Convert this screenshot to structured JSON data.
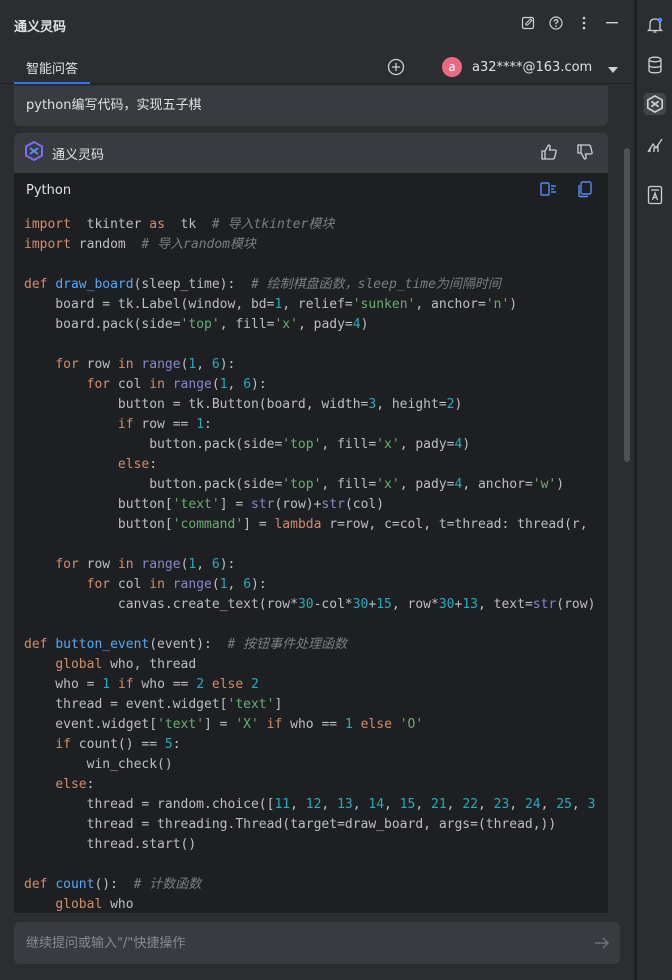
{
  "window": {
    "title": "通义灵码"
  },
  "tabs": [
    {
      "label": "智能问答"
    }
  ],
  "account": {
    "avatar_letter": "a",
    "email": "a32****@163.com"
  },
  "user_message": "python编写代码，实现五子棋",
  "answer": {
    "bot_name": "通义灵码",
    "code_language": "Python"
  },
  "code_lines": [
    [
      [
        "kw",
        "import"
      ],
      [
        "",
        "  tkinter "
      ],
      [
        "kw",
        "as"
      ],
      [
        "",
        "  tk  "
      ],
      [
        "cm",
        "# 导入tkinter模块"
      ]
    ],
    [
      [
        "kw",
        "import"
      ],
      [
        "",
        " random  "
      ],
      [
        "cm",
        "# 导入random模块"
      ]
    ],
    [],
    [
      [
        "kw",
        "def"
      ],
      [
        "",
        " "
      ],
      [
        "fn",
        "draw_board"
      ],
      [
        "",
        "(sleep_time):  "
      ],
      [
        "cm",
        "# 绘制棋盘函数，sleep_time为间隔时间"
      ]
    ],
    [
      [
        "",
        "    board = tk.Label(window, bd="
      ],
      [
        "num",
        "1"
      ],
      [
        "",
        ", relief="
      ],
      [
        "str",
        "'sunken'"
      ],
      [
        "",
        ", anchor="
      ],
      [
        "str",
        "'n'"
      ],
      [
        "",
        ")"
      ]
    ],
    [
      [
        "",
        "    board.pack(side="
      ],
      [
        "str",
        "'top'"
      ],
      [
        "",
        ", fill="
      ],
      [
        "str",
        "'x'"
      ],
      [
        "",
        ", pady="
      ],
      [
        "num",
        "4"
      ],
      [
        "",
        ")"
      ]
    ],
    [],
    [
      [
        "",
        "    "
      ],
      [
        "kw",
        "for"
      ],
      [
        "",
        " row "
      ],
      [
        "kw",
        "in"
      ],
      [
        "",
        " "
      ],
      [
        "bi",
        "range"
      ],
      [
        "",
        "("
      ],
      [
        "num",
        "1"
      ],
      [
        "",
        ", "
      ],
      [
        "num",
        "6"
      ],
      [
        "",
        "):"
      ]
    ],
    [
      [
        "",
        "        "
      ],
      [
        "kw",
        "for"
      ],
      [
        "",
        " col "
      ],
      [
        "kw",
        "in"
      ],
      [
        "",
        " "
      ],
      [
        "bi",
        "range"
      ],
      [
        "",
        "("
      ],
      [
        "num",
        "1"
      ],
      [
        "",
        ", "
      ],
      [
        "num",
        "6"
      ],
      [
        "",
        "):"
      ]
    ],
    [
      [
        "",
        "            button = tk.Button(board, width="
      ],
      [
        "num",
        "3"
      ],
      [
        "",
        ", height="
      ],
      [
        "num",
        "2"
      ],
      [
        "",
        ")"
      ]
    ],
    [
      [
        "",
        "            "
      ],
      [
        "kw",
        "if"
      ],
      [
        "",
        " row == "
      ],
      [
        "num",
        "1"
      ],
      [
        "",
        ":"
      ]
    ],
    [
      [
        "",
        "                button.pack(side="
      ],
      [
        "str",
        "'top'"
      ],
      [
        "",
        ", fill="
      ],
      [
        "str",
        "'x'"
      ],
      [
        "",
        ", pady="
      ],
      [
        "num",
        "4"
      ],
      [
        "",
        ")"
      ]
    ],
    [
      [
        "",
        "            "
      ],
      [
        "kw",
        "else"
      ],
      [
        "",
        ":"
      ]
    ],
    [
      [
        "",
        "                button.pack(side="
      ],
      [
        "str",
        "'top'"
      ],
      [
        "",
        ", fill="
      ],
      [
        "str",
        "'x'"
      ],
      [
        "",
        ", pady="
      ],
      [
        "num",
        "4"
      ],
      [
        "",
        ", anchor="
      ],
      [
        "str",
        "'w'"
      ],
      [
        "",
        ")"
      ]
    ],
    [
      [
        "",
        "            button["
      ],
      [
        "str",
        "'text'"
      ],
      [
        "",
        "] = "
      ],
      [
        "bi",
        "str"
      ],
      [
        "",
        "(row)+"
      ],
      [
        "bi",
        "str"
      ],
      [
        "",
        "(col)"
      ]
    ],
    [
      [
        "",
        "            button["
      ],
      [
        "str",
        "'command'"
      ],
      [
        "",
        "] = "
      ],
      [
        "kw",
        "lambda"
      ],
      [
        "",
        " r=row, c=col, t=thread: thread(r,"
      ]
    ],
    [],
    [
      [
        "",
        "    "
      ],
      [
        "kw",
        "for"
      ],
      [
        "",
        " row "
      ],
      [
        "kw",
        "in"
      ],
      [
        "",
        " "
      ],
      [
        "bi",
        "range"
      ],
      [
        "",
        "("
      ],
      [
        "num",
        "1"
      ],
      [
        "",
        ", "
      ],
      [
        "num",
        "6"
      ],
      [
        "",
        "):"
      ]
    ],
    [
      [
        "",
        "        "
      ],
      [
        "kw",
        "for"
      ],
      [
        "",
        " col "
      ],
      [
        "kw",
        "in"
      ],
      [
        "",
        " "
      ],
      [
        "bi",
        "range"
      ],
      [
        "",
        "("
      ],
      [
        "num",
        "1"
      ],
      [
        "",
        ", "
      ],
      [
        "num",
        "6"
      ],
      [
        "",
        "):"
      ]
    ],
    [
      [
        "",
        "            canvas.create_text(row*"
      ],
      [
        "num",
        "30"
      ],
      [
        "",
        "-col*"
      ],
      [
        "num",
        "30"
      ],
      [
        "",
        "+"
      ],
      [
        "num",
        "15"
      ],
      [
        "",
        ", row*"
      ],
      [
        "num",
        "30"
      ],
      [
        "",
        "+"
      ],
      [
        "num",
        "13"
      ],
      [
        "",
        ", text="
      ],
      [
        "bi",
        "str"
      ],
      [
        "",
        "(row)"
      ]
    ],
    [],
    [
      [
        "kw",
        "def"
      ],
      [
        "",
        " "
      ],
      [
        "fn",
        "button_event"
      ],
      [
        "",
        "(event):  "
      ],
      [
        "cm",
        "# 按钮事件处理函数"
      ]
    ],
    [
      [
        "",
        "    "
      ],
      [
        "kw",
        "global"
      ],
      [
        "",
        " who, thread"
      ]
    ],
    [
      [
        "",
        "    who = "
      ],
      [
        "num",
        "1"
      ],
      [
        "",
        " "
      ],
      [
        "kw",
        "if"
      ],
      [
        "",
        " who == "
      ],
      [
        "num",
        "2"
      ],
      [
        "",
        " "
      ],
      [
        "kw",
        "else"
      ],
      [
        "",
        " "
      ],
      [
        "num",
        "2"
      ]
    ],
    [
      [
        "",
        "    thread = event.widget["
      ],
      [
        "str",
        "'text'"
      ],
      [
        "",
        "]"
      ]
    ],
    [
      [
        "",
        "    event.widget["
      ],
      [
        "str",
        "'text'"
      ],
      [
        "",
        "] = "
      ],
      [
        "str",
        "'X'"
      ],
      [
        "",
        " "
      ],
      [
        "kw",
        "if"
      ],
      [
        "",
        " who == "
      ],
      [
        "num",
        "1"
      ],
      [
        "",
        " "
      ],
      [
        "kw",
        "else"
      ],
      [
        "",
        " "
      ],
      [
        "str",
        "'O'"
      ]
    ],
    [
      [
        "",
        "    "
      ],
      [
        "kw",
        "if"
      ],
      [
        "",
        " count() == "
      ],
      [
        "num",
        "5"
      ],
      [
        "",
        ":"
      ]
    ],
    [
      [
        "",
        "        win_check()"
      ]
    ],
    [
      [
        "",
        "    "
      ],
      [
        "kw",
        "else"
      ],
      [
        "",
        ":"
      ]
    ],
    [
      [
        "",
        "        thread = random.choice(["
      ],
      [
        "num",
        "11"
      ],
      [
        "",
        ", "
      ],
      [
        "num",
        "12"
      ],
      [
        "",
        ", "
      ],
      [
        "num",
        "13"
      ],
      [
        "",
        ", "
      ],
      [
        "num",
        "14"
      ],
      [
        "",
        ", "
      ],
      [
        "num",
        "15"
      ],
      [
        "",
        ", "
      ],
      [
        "num",
        "21"
      ],
      [
        "",
        ", "
      ],
      [
        "num",
        "22"
      ],
      [
        "",
        ", "
      ],
      [
        "num",
        "23"
      ],
      [
        "",
        ", "
      ],
      [
        "num",
        "24"
      ],
      [
        "",
        ", "
      ],
      [
        "num",
        "25"
      ],
      [
        "",
        ", "
      ],
      [
        "num",
        "3"
      ]
    ],
    [
      [
        "",
        "        thread = threading.Thread(target=draw_board, args=(thread,))"
      ]
    ],
    [
      [
        "",
        "        thread.start()"
      ]
    ],
    [],
    [
      [
        "kw",
        "def"
      ],
      [
        "",
        " "
      ],
      [
        "fn",
        "count"
      ],
      [
        "",
        "():  "
      ],
      [
        "cm",
        "# 计数函数"
      ]
    ],
    [
      [
        "",
        "    "
      ],
      [
        "kw",
        "global"
      ],
      [
        "",
        " who"
      ]
    ]
  ],
  "input": {
    "placeholder": "继续提问或输入\"/\"快捷操作"
  },
  "icons": {
    "title_actions": [
      "edit-icon",
      "help-icon",
      "more-icon",
      "minimize-icon"
    ],
    "rail": [
      "notifications-icon",
      "database-icon",
      "tongyi-lingma-icon",
      "profiler-icon",
      "bookmark-icon"
    ]
  },
  "colors": {
    "accent": "#3574f0",
    "avatar": "#e96a83"
  }
}
